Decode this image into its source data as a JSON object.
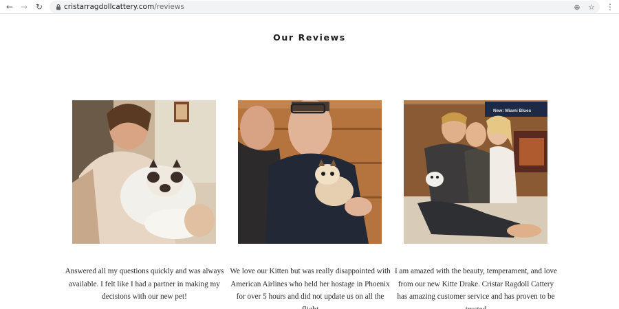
{
  "browser": {
    "url_domain": "cristarragdollcattery.com",
    "url_path": "/reviews"
  },
  "icons": {
    "back": "arrow-left-icon",
    "forward": "arrow-right-icon",
    "reload": "reload-icon",
    "lock": "lock-icon",
    "install": "install-app-icon",
    "bookmark": "star-icon",
    "menu": "kebab-menu-icon"
  },
  "page": {
    "title": "Our Reviews"
  },
  "reviews": [
    {
      "photo_alt": "photo-woman-holding-kitten",
      "text": "Answered all my questions quickly and was always available. I felt like I had a partner in making my decisions with our new pet!"
    },
    {
      "photo_alt": "photo-two-men-holding-kitten",
      "text": "We love our Kitten but was really disappointed with American Airlines who held her hostage in Phoenix for over 5 hours and did not update us on all the flight"
    },
    {
      "photo_alt": "photo-family-with-kitten",
      "text": "I am amazed with the beauty, temperament, and love from our new Kitte Drake. Cristar Ragdoll Cattery  has amazing customer service and has proven to be trusted"
    }
  ],
  "photo3_tv_text": "New: Miami Blues"
}
